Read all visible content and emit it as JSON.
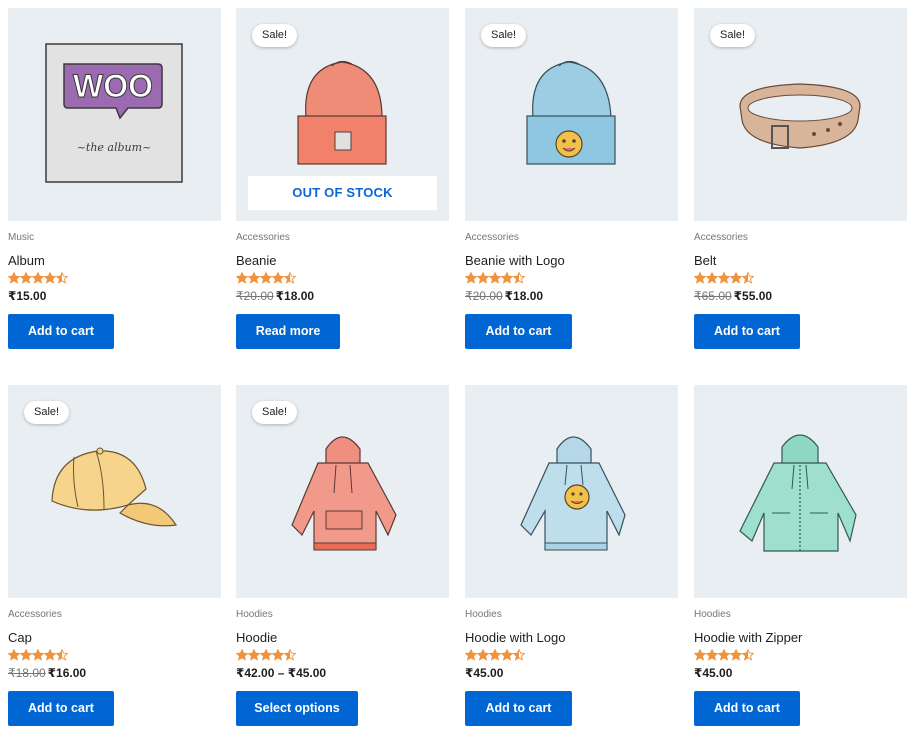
{
  "products": [
    {
      "category": "Music",
      "title": "Album",
      "price_old": "",
      "price": "₹15.00",
      "button": "Add to cart",
      "sale": "",
      "stock": "",
      "rating": 4.5,
      "icon": "album-icon"
    },
    {
      "category": "Accessories",
      "title": "Beanie",
      "price_old": "₹20.00",
      "price": "₹18.00",
      "button": "Read more",
      "sale": "Sale!",
      "stock": "OUT OF STOCK",
      "rating": 4.5,
      "icon": "beanie-icon"
    },
    {
      "category": "Accessories",
      "title": "Beanie with Logo",
      "price_old": "₹20.00",
      "price": "₹18.00",
      "button": "Add to cart",
      "sale": "Sale!",
      "stock": "",
      "rating": 4.5,
      "icon": "beanie-logo-icon"
    },
    {
      "category": "Accessories",
      "title": "Belt",
      "price_old": "₹65.00",
      "price": "₹55.00",
      "button": "Add to cart",
      "sale": "Sale!",
      "stock": "",
      "rating": 4.5,
      "icon": "belt-icon"
    },
    {
      "category": "Accessories",
      "title": "Cap",
      "price_old": "₹18.00",
      "price": "₹16.00",
      "button": "Add to cart",
      "sale": "Sale!",
      "stock": "",
      "rating": 4.5,
      "icon": "cap-icon"
    },
    {
      "category": "Hoodies",
      "title": "Hoodie",
      "price_old": "",
      "price": "₹42.00 – ₹45.00",
      "button": "Select options",
      "sale": "Sale!",
      "stock": "",
      "rating": 4.5,
      "icon": "hoodie-icon"
    },
    {
      "category": "Hoodies",
      "title": "Hoodie with Logo",
      "price_old": "",
      "price": "₹45.00",
      "button": "Add to cart",
      "sale": "",
      "stock": "",
      "rating": 4.5,
      "icon": "hoodie-logo-icon"
    },
    {
      "category": "Hoodies",
      "title": "Hoodie with Zipper",
      "price_old": "",
      "price": "₹45.00",
      "button": "Add to cart",
      "sale": "",
      "stock": "",
      "rating": 4.5,
      "icon": "hoodie-zipper-icon"
    }
  ],
  "album_art": {
    "logo_text": "WOO",
    "subtitle": "~the album~"
  },
  "colors": {
    "accent": "#0066d4",
    "star": "#f0933f",
    "thumb_bg": "#e9eef2"
  }
}
